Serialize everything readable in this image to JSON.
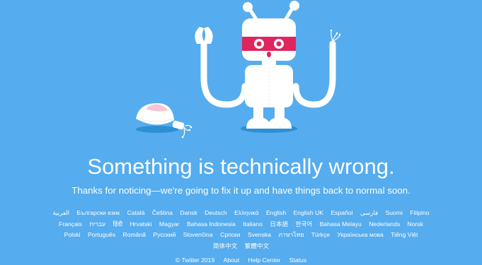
{
  "headline": "Something is technically wrong.",
  "subtext": "Thanks for noticing—we're going to fix it up and have things back to normal soon.",
  "languages": [
    "العربية",
    "Български език",
    "Català",
    "Čeština",
    "Dansk",
    "Deutsch",
    "Ελληνικά",
    "English",
    "English UK",
    "Español",
    "فارسی",
    "Suomi",
    "Filipino",
    "Français",
    "עברית",
    "हिंदी",
    "Hrvatski",
    "Magyar",
    "Bahasa Indonesia",
    "Italiano",
    "日本語",
    "한국어",
    "Bahasa Melayu",
    "Nederlands",
    "Norsk",
    "Polski",
    "Português",
    "Română",
    "Русский",
    "Slovenčina",
    "Српски",
    "Svenska",
    "ภาษาไทย",
    "Türkçe",
    "Українська мова",
    "Tiếng Việt",
    "简体中文",
    "繁體中文"
  ],
  "footer": {
    "copyright": "© Twitter 2019",
    "about": "About",
    "help_center": "Help Center",
    "status": "Status"
  },
  "colors": {
    "background": "#55acee",
    "text": "#ffffff",
    "robot_eyes": "#e0245e"
  },
  "illustration": {
    "name": "broken-robot-illustration"
  }
}
